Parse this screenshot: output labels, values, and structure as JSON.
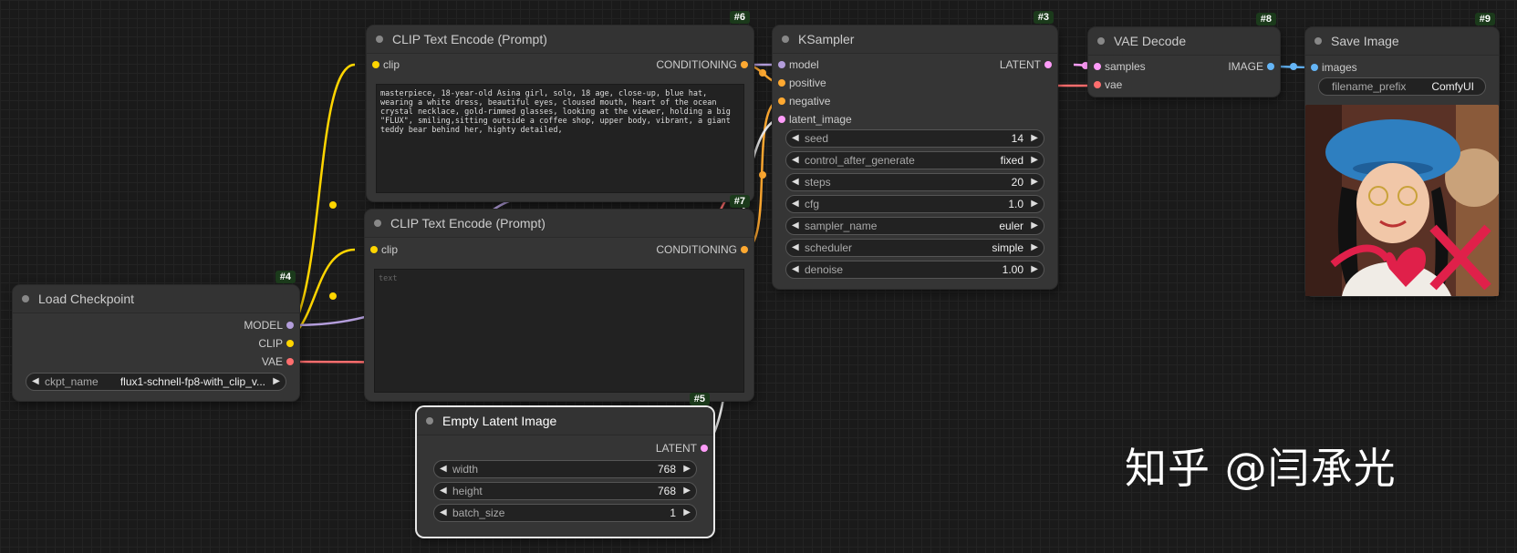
{
  "nodes": {
    "clip_pos": {
      "id": "#6",
      "title": "CLIP Text Encode (Prompt)",
      "input": "clip",
      "output": "CONDITIONING",
      "text": "masterpiece, 18-year-old Asina girl, solo, 18 age, close-up, blue hat, wearing a white dress, beautiful eyes, cloused mouth, heart of the ocean crystal necklace, gold-rimmed glasses, looking at the viewer, holding a big \"FLUX\", smiling,sitting outside a coffee shop, upper body, vibrant, a giant teddy bear behind her, highty detailed,"
    },
    "clip_neg": {
      "id": "#7",
      "title": "CLIP Text Encode (Prompt)",
      "input": "clip",
      "output": "CONDITIONING",
      "placeholder": "text"
    },
    "ksampler": {
      "id": "#3",
      "title": "KSampler",
      "inputs": [
        "model",
        "positive",
        "negative",
        "latent_image"
      ],
      "output": "LATENT",
      "widgets": [
        {
          "label": "seed",
          "value": "14"
        },
        {
          "label": "control_after_generate",
          "value": "fixed"
        },
        {
          "label": "steps",
          "value": "20"
        },
        {
          "label": "cfg",
          "value": "1.0"
        },
        {
          "label": "sampler_name",
          "value": "euler"
        },
        {
          "label": "scheduler",
          "value": "simple"
        },
        {
          "label": "denoise",
          "value": "1.00"
        }
      ]
    },
    "vae_decode": {
      "id": "#8",
      "title": "VAE Decode",
      "inputs": [
        "samples",
        "vae"
      ],
      "output": "IMAGE"
    },
    "save_image": {
      "id": "#9",
      "title": "Save Image",
      "input": "images",
      "prefix_label": "filename_prefix",
      "prefix_value": "ComfyUI"
    },
    "checkpoint": {
      "id": "#4",
      "title": "Load Checkpoint",
      "outputs": [
        "MODEL",
        "CLIP",
        "VAE"
      ],
      "widget_label": "ckpt_name",
      "widget_value": "flux1-schnell-fp8-with_clip_v..."
    },
    "latent": {
      "id": "#5",
      "title": "Empty Latent Image",
      "output": "LATENT",
      "widgets": [
        {
          "label": "width",
          "value": "768"
        },
        {
          "label": "height",
          "value": "768"
        },
        {
          "label": "batch_size",
          "value": "1"
        }
      ]
    }
  },
  "watermark": "知乎 @闫承光",
  "colors": {
    "model": "#b39ddb",
    "clip": "#ffd500",
    "vae": "#ff6e6e",
    "conditioning": "#ffa931",
    "latent": "#ff9cf9",
    "image": "#64b5f6",
    "background": "#1a1a1a",
    "node": "#353535"
  }
}
